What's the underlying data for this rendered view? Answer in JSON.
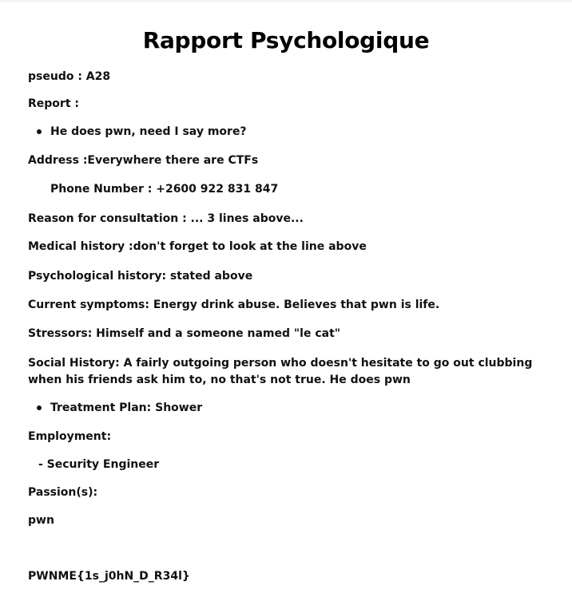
{
  "title": "Rapport Psychologique",
  "pseudo": "pseudo : A28",
  "report_label": "Report :",
  "report_bullet": "He does pwn, need I say more?",
  "address": "Address :Everywhere there are CTFs",
  "phone": "Phone Number : +2600 922 831 847",
  "reason": "Reason for consultation :  ... 3 lines above...",
  "medical": "Medical history :don't forget to look at the line above",
  "psychological": "Psychological history: stated above",
  "symptoms": "Current symptoms: Energy drink abuse. Believes that pwn is life.",
  "stressors": "Stressors: Himself and a someone named \"le cat\"",
  "social": "Social History: A fairly outgoing person who doesn't hesitate to go out clubbing when his friends ask him to, no that's not true. He does pwn",
  "treatment_bullet": "Treatment Plan: Shower",
  "employment_label": "Employment:",
  "employment_item": "- Security Engineer",
  "passion_label": "Passion(s):",
  "passion_value": "pwn",
  "flag": "PWNME{1s_j0hN_D_R34l}"
}
